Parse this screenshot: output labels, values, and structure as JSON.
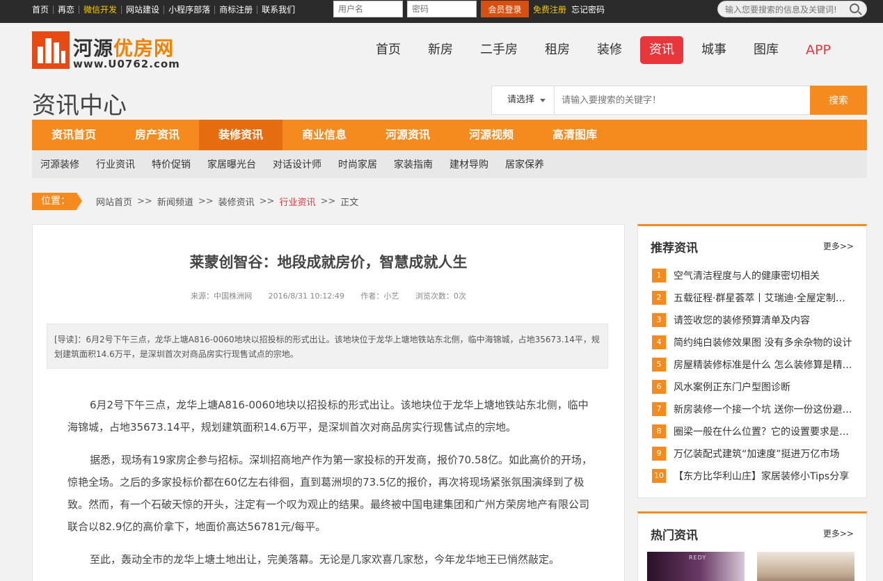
{
  "topbar": {
    "links": [
      "首页",
      "再恋",
      "微信开发",
      "网站建设",
      "小程序部落",
      "商标注册",
      "联系我们"
    ],
    "username_placeholder": "用户名",
    "password_placeholder": "密码",
    "login_label": "会员登录",
    "register_label": "免费注册",
    "forgot_label": "忘记密码",
    "search_placeholder": "输入您要搜索的信息及关键词!"
  },
  "logo": {
    "name_main": "河源",
    "name_accent": "优房网",
    "url": "www.U0762.com"
  },
  "main_nav": [
    "首页",
    "新房",
    "二手房",
    "租房",
    "装修",
    "资讯",
    "城事",
    "图库",
    "APP"
  ],
  "page_title": "资讯中心",
  "search": {
    "select_label": "请选择",
    "placeholder": "请输入要搜索的关键字！",
    "button_label": "搜索"
  },
  "category_nav": [
    "资讯首页",
    "房产资讯",
    "装修资讯",
    "商业信息",
    "河源资讯",
    "河源视频",
    "高清图库"
  ],
  "sub_nav": [
    "河源装修",
    "行业资讯",
    "特价促销",
    "家居曝光台",
    "对话设计师",
    "时尚家居",
    "家装指南",
    "建材导购",
    "居家保养"
  ],
  "breadcrumb": {
    "label": "位置：",
    "items": [
      "网站首页",
      "新闻频道",
      "装修资讯",
      "行业资讯",
      "正文"
    ],
    "separator": ">>"
  },
  "article": {
    "title": "莱蒙创智谷：地段成就房价，智慧成就人生",
    "source": "来源：中国株洲网",
    "date": "2016/8/31 10:12:49",
    "author": "作者：小艺",
    "views": "浏览次数：0次",
    "lead": "[导读]：6月2号下午三点，龙华上塘A816-0060地块以招投标的形式出让。该地块位于龙华上塘地铁站东北侧，临中海锦城，占地35673.14平，规划建筑面积14.6万平，是深圳首次对商品房实行现售试点的宗地。",
    "paragraphs": [
      "6月2号下午三点，龙华上塘A816-0060地块以招投标的形式出让。该地块位于龙华上塘地铁站东北侧，临中海锦城，占地35673.14平，规划建筑面积14.6万平，是深圳首次对商品房实行现售试点的宗地。",
      "据悉，现场有19家房企参与招标。深圳招商地产作为第一家投标的开发商，报价70.58亿。如此高价的开场，惊艳全场。之后的多家投标价都在60亿左右徘徊，直到葛洲坝的73.5亿的报价，再次将现场紧张氛围演绎到了极致。然而，有一个石破天惊的开头，注定有一个叹为观止的结果。最终被中国电建集团和广州方荣房地产有限公司联合以82.9亿的高价拿下，地面价高达56781元/每平。",
      "至此，轰动全市的龙华上塘土地出让，完美落幕。无论是几家欢喜几家愁，今年龙华地王已悄然敲定。"
    ]
  },
  "recommended": {
    "title": "推荐资讯",
    "more": "更多>>",
    "items": [
      "空气清洁程度与人的健康密切相关",
      "五载征程·群星荟萃丨艾瑞迪·全屋定制家居",
      "请签收您的装修预算清单及内容",
      "简约纯白装修效果图 没有多余杂物的设计",
      "房屋精装修标准是什么 怎么装修算是精装修",
      "风水案例正东门户型图诊断",
      "新房装修一个接一个坑 送你一份这份避坑指南",
      "圈梁一般在什么位置？它的设置要求是什么",
      "万亿装配式建筑“加速度”挺进万亿市场",
      "【东方比华利山庄】家居装修小Tips分享"
    ]
  },
  "hot": {
    "title": "热门资讯",
    "more": "更多>>",
    "thumb1_text": "REDY"
  },
  "colors": {
    "accent_orange": "#f58a1f",
    "active_red": "#e8363b",
    "topbar": "#2b2b2b"
  }
}
